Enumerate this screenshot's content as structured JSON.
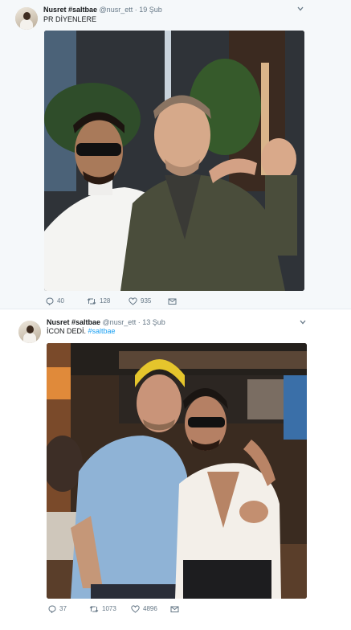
{
  "tweets": [
    {
      "name": "Nusret #saltbae",
      "handle": "@nusr_ett",
      "separator": "·",
      "date": "19 Şub",
      "text": "PR DİYENLERE",
      "hashtag": "",
      "replies": "40",
      "retweets": "128",
      "likes": "935"
    },
    {
      "name": "Nusret #saltbae",
      "handle": "@nusr_ett",
      "separator": "·",
      "date": "13 Şub",
      "text": "İCON DEDİ. ",
      "hashtag": "#saltbae",
      "replies": "37",
      "retweets": "1073",
      "likes": "4896"
    }
  ],
  "colors": {
    "link": "#1da1f2",
    "muted": "#657786",
    "text": "#14171a",
    "like_icon": "#657786"
  },
  "icons": [
    "chevron-down-icon",
    "reply-icon",
    "retweet-icon",
    "like-icon",
    "message-icon"
  ]
}
